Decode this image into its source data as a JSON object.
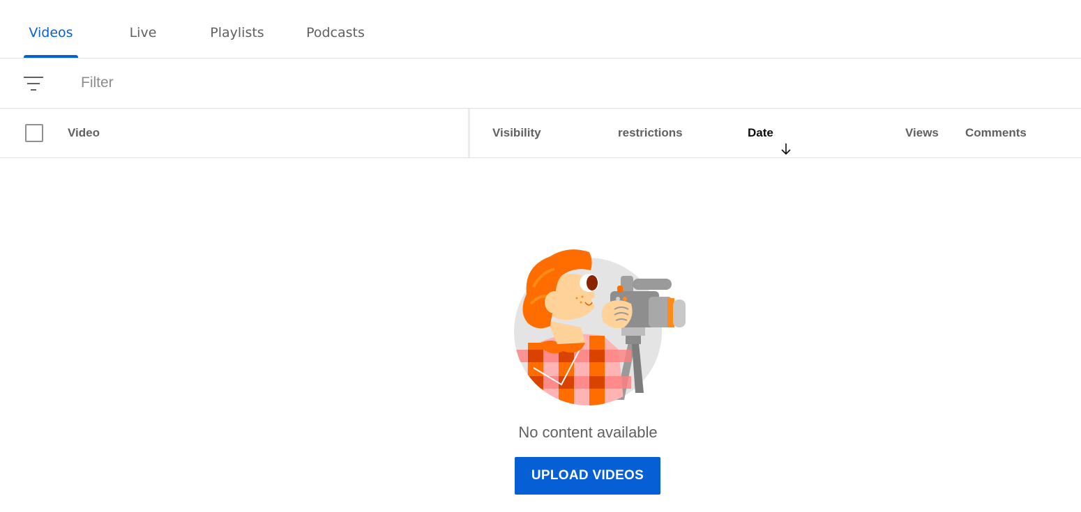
{
  "tabs": [
    {
      "label": "Videos",
      "active": true
    },
    {
      "label": "Live",
      "active": false
    },
    {
      "label": "Playlists",
      "active": false
    },
    {
      "label": "Podcasts",
      "active": false
    }
  ],
  "filter": {
    "icon": "filter-lines-icon",
    "placeholder": "Filter",
    "value": ""
  },
  "table": {
    "select_all_checked": false,
    "columns": [
      {
        "label": "Video"
      },
      {
        "label": "Visibility"
      },
      {
        "label": "restrictions"
      },
      {
        "label": "Date",
        "sorted": "descending",
        "sort_icon": "arrow-down-icon"
      },
      {
        "label": "Views"
      },
      {
        "label": "Comments"
      }
    ],
    "rows": []
  },
  "empty_state": {
    "illustration": "person-with-video-camera-illustration",
    "message": "No content available",
    "button_label": "UPLOAD VIDEOS"
  },
  "colors": {
    "accent": "#065fd4",
    "text_secondary": "#606060",
    "divider": "#e0e0e0"
  }
}
